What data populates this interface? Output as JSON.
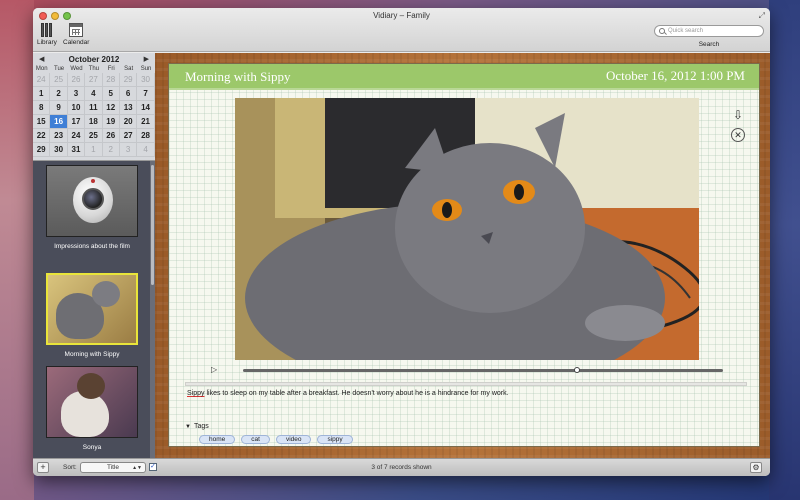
{
  "window": {
    "title": "Vidiary – Family"
  },
  "toolbar": {
    "library_label": "Library",
    "calendar_label": "Calendar",
    "search_placeholder": "Quick search",
    "search_label": "Search"
  },
  "calendar": {
    "month_label": "October 2012",
    "day_names": [
      "Mon",
      "Tue",
      "Wed",
      "Thu",
      "Fri",
      "Sat",
      "Sun"
    ],
    "days": [
      {
        "n": "24",
        "muted": true
      },
      {
        "n": "25",
        "muted": true
      },
      {
        "n": "26",
        "muted": true
      },
      {
        "n": "27",
        "muted": true
      },
      {
        "n": "28",
        "muted": true
      },
      {
        "n": "29",
        "muted": true
      },
      {
        "n": "30",
        "muted": true
      },
      {
        "n": "1"
      },
      {
        "n": "2"
      },
      {
        "n": "3"
      },
      {
        "n": "4"
      },
      {
        "n": "5"
      },
      {
        "n": "6"
      },
      {
        "n": "7"
      },
      {
        "n": "8"
      },
      {
        "n": "9"
      },
      {
        "n": "10"
      },
      {
        "n": "11"
      },
      {
        "n": "12"
      },
      {
        "n": "13"
      },
      {
        "n": "14"
      },
      {
        "n": "15"
      },
      {
        "n": "16",
        "today": true
      },
      {
        "n": "17"
      },
      {
        "n": "18"
      },
      {
        "n": "19"
      },
      {
        "n": "20"
      },
      {
        "n": "21"
      },
      {
        "n": "22"
      },
      {
        "n": "23"
      },
      {
        "n": "24"
      },
      {
        "n": "25"
      },
      {
        "n": "26"
      },
      {
        "n": "27"
      },
      {
        "n": "28"
      },
      {
        "n": "29"
      },
      {
        "n": "30"
      },
      {
        "n": "31"
      },
      {
        "n": "1",
        "muted": true
      },
      {
        "n": "2",
        "muted": true
      },
      {
        "n": "3",
        "muted": true
      },
      {
        "n": "4",
        "muted": true
      }
    ]
  },
  "entries": [
    {
      "title": "Impressions about the film",
      "thumb": "camera"
    },
    {
      "title": "Morning with Sippy",
      "thumb": "cat",
      "selected": true
    },
    {
      "title": "Sonya",
      "thumb": "cat3"
    }
  ],
  "entry": {
    "title": "Morning with Sippy",
    "date": "October 16, 2012 1:00 PM",
    "caption_first_word": "Sippy",
    "caption_rest": " likes to sleep on my table after a breakfast. He doesn't worry about he is a hindrance for my work.",
    "tags_label": "Tags",
    "tags": [
      "home",
      "cat",
      "video",
      "sippy"
    ],
    "playback_progress_fraction": 0.695
  },
  "bottombar": {
    "add_label": "+",
    "sort_label": "Sort:",
    "sort_value": "Title",
    "sort_checked": true,
    "records_text": "3 of 7 records shown"
  },
  "colors": {
    "header_green": "#9cc86a",
    "today_blue": "#3f7fd6",
    "selected_border": "#e9e53a"
  }
}
